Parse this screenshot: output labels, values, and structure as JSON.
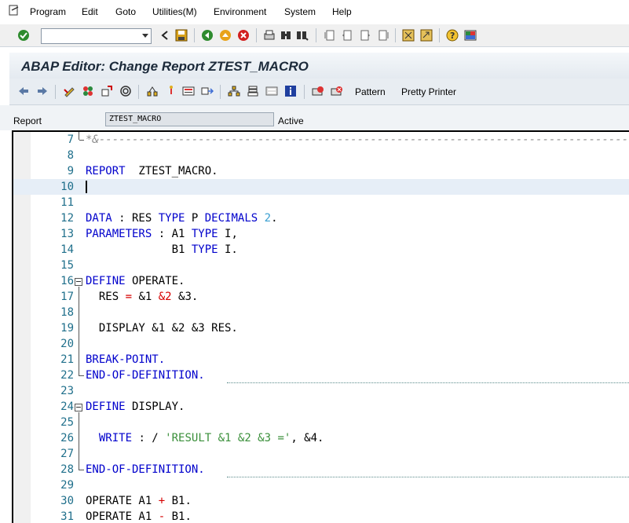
{
  "menu": [
    "Program",
    "Edit",
    "Goto",
    "Utilities(M)",
    "Environment",
    "System",
    "Help"
  ],
  "command_field": {
    "value": ""
  },
  "title": "ABAP Editor: Change Report ZTEST_MACRO",
  "app_toolbar": {
    "pattern_label": "Pattern",
    "pretty_printer_label": "Pretty Printer"
  },
  "header": {
    "report_label": "Report",
    "report_value": "ZTEST_MACRO",
    "status": "Active"
  },
  "editor": {
    "lines": [
      {
        "n": "7",
        "parts": [
          {
            "t": "*&",
            "c": "cmt"
          }
        ]
      },
      {
        "n": "8",
        "parts": []
      },
      {
        "n": "9",
        "parts": [
          {
            "t": "REPORT",
            "c": "kw"
          },
          {
            "t": "  ZTEST_MACRO."
          }
        ]
      },
      {
        "n": "10",
        "parts": []
      },
      {
        "n": "11",
        "parts": []
      },
      {
        "n": "12",
        "parts": [
          {
            "t": "DATA",
            "c": "kw"
          },
          {
            "t": " : RES "
          },
          {
            "t": "TYPE",
            "c": "kw"
          },
          {
            "t": " P "
          },
          {
            "t": "DECIMALS",
            "c": "kw"
          },
          {
            "t": " "
          },
          {
            "t": "2",
            "c": "num"
          },
          {
            "t": "."
          }
        ]
      },
      {
        "n": "13",
        "parts": [
          {
            "t": "PARAMETERS",
            "c": "kw"
          },
          {
            "t": " : A1 "
          },
          {
            "t": "TYPE",
            "c": "kw"
          },
          {
            "t": " I,"
          }
        ]
      },
      {
        "n": "14",
        "parts": [
          {
            "t": "             B1 "
          },
          {
            "t": "TYPE",
            "c": "kw"
          },
          {
            "t": " I."
          }
        ]
      },
      {
        "n": "15",
        "parts": []
      },
      {
        "n": "16",
        "parts": [
          {
            "t": "DEFINE",
            "c": "kw"
          },
          {
            "t": " OPERATE."
          }
        ]
      },
      {
        "n": "17",
        "parts": [
          {
            "t": "  RES "
          },
          {
            "t": "=",
            "c": "red"
          },
          {
            "t": " &1 "
          },
          {
            "t": "&2",
            "c": "red"
          },
          {
            "t": " &3."
          }
        ]
      },
      {
        "n": "18",
        "parts": []
      },
      {
        "n": "19",
        "parts": [
          {
            "t": "  DISPLAY &1 &2 &3 RES."
          }
        ]
      },
      {
        "n": "20",
        "parts": []
      },
      {
        "n": "21",
        "parts": [
          {
            "t": "BREAK-POINT.",
            "c": "kw"
          }
        ]
      },
      {
        "n": "22",
        "parts": [
          {
            "t": "END-OF-DEFINITION.",
            "c": "kw"
          }
        ]
      },
      {
        "n": "23",
        "parts": []
      },
      {
        "n": "24",
        "parts": [
          {
            "t": "DEFINE",
            "c": "kw"
          },
          {
            "t": " DISPLAY."
          }
        ]
      },
      {
        "n": "25",
        "parts": []
      },
      {
        "n": "26",
        "parts": [
          {
            "t": "  "
          },
          {
            "t": "WRITE",
            "c": "kw"
          },
          {
            "t": " : / "
          },
          {
            "t": "'RESULT &1 &2 &3 ='",
            "c": "str"
          },
          {
            "t": ", &4."
          }
        ]
      },
      {
        "n": "27",
        "parts": []
      },
      {
        "n": "28",
        "parts": [
          {
            "t": "END-OF-DEFINITION.",
            "c": "kw"
          }
        ]
      },
      {
        "n": "29",
        "parts": []
      },
      {
        "n": "30",
        "parts": [
          {
            "t": "OPERATE A1 "
          },
          {
            "t": "+",
            "c": "red"
          },
          {
            "t": " B1."
          }
        ]
      },
      {
        "n": "31",
        "parts": [
          {
            "t": "OPERATE A1 "
          },
          {
            "t": "-",
            "c": "red"
          },
          {
            "t": " B1."
          }
        ]
      }
    ]
  }
}
